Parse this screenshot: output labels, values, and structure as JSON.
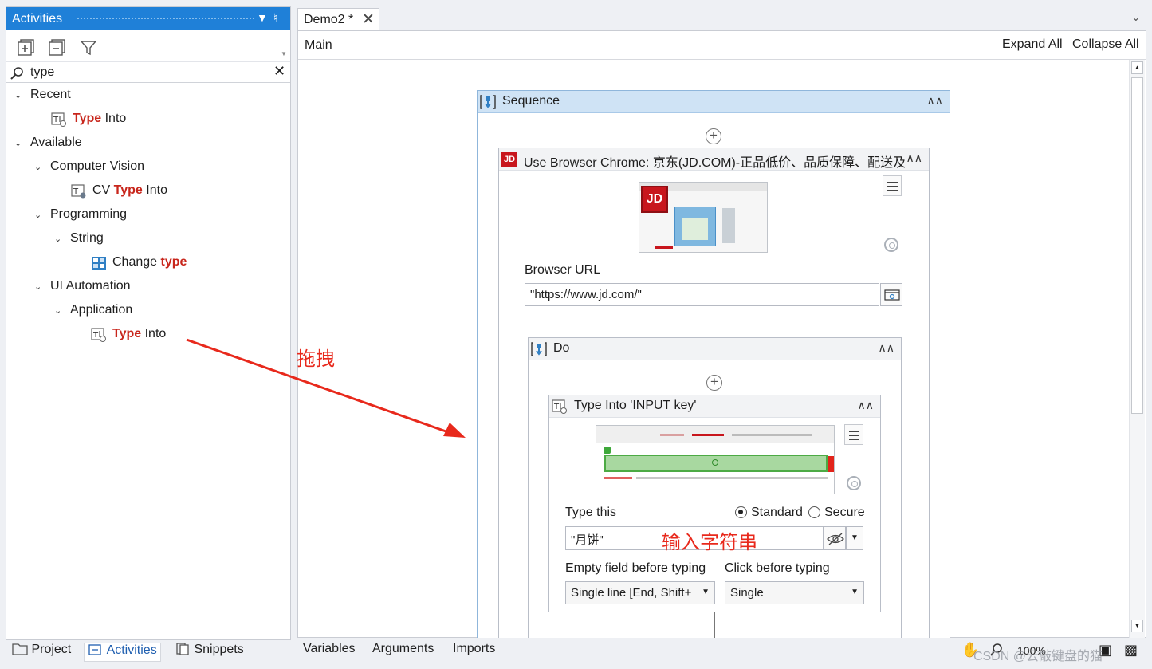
{
  "activities": {
    "title": "Activities",
    "search_value": "type",
    "tree": {
      "recent": "Recent",
      "recent_item": {
        "hl": "Type",
        "rest": " Into"
      },
      "available": "Available",
      "computer_vision": "Computer Vision",
      "cv_item": {
        "pre": "CV ",
        "hl": "Type",
        "rest": " Into"
      },
      "programming": "Programming",
      "string": "String",
      "change_type": {
        "pre": "Change ",
        "hl": "type"
      },
      "ui_automation": "UI Automation",
      "application": "Application",
      "app_item": {
        "hl": "Type",
        "rest": " Into"
      }
    }
  },
  "bottom_tabs": {
    "project": "Project",
    "activities": "Activities",
    "snippets": "Snippets"
  },
  "document": {
    "tab_label": "Demo2 *",
    "breadcrumb": "Main",
    "expand_all": "Expand All",
    "collapse_all": "Collapse All"
  },
  "sequence": {
    "label": "Sequence"
  },
  "use_browser": {
    "label": "Use Browser Chrome: 京东(JD.COM)-正品低价、品质保障、配送及时",
    "url_label": "Browser URL",
    "url_value": "\"https://www.jd.com/\"",
    "logo_text": "JD"
  },
  "do_box": {
    "label": "Do"
  },
  "type_into": {
    "label": "Type Into 'INPUT key'",
    "type_this_label": "Type this",
    "radio_standard": "Standard",
    "radio_secure": "Secure",
    "text_value": "\"月饼\"",
    "empty_field_label": "Empty field before typing",
    "empty_field_value": "Single line [End, Shift+",
    "click_label": "Click before typing",
    "click_value": "Single"
  },
  "annotations": {
    "drag": "拖拽",
    "input_string": "输入字符串",
    "arrow_color": "#e8291c"
  },
  "bottom_bar": {
    "variables": "Variables",
    "arguments": "Arguments",
    "imports": "Imports",
    "zoom": "100%",
    "watermark": "CSDN @云敲键盘的猫"
  }
}
